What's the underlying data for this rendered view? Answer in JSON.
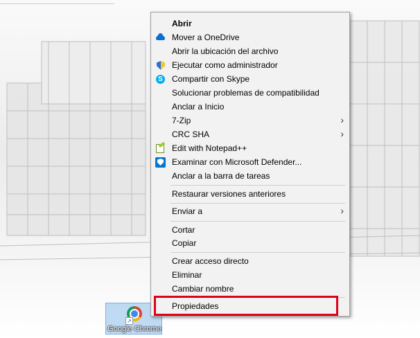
{
  "desktop": {
    "icon_label": "Google Chrome"
  },
  "menu": {
    "items": [
      {
        "label": "Abrir",
        "icon": "none",
        "submenu": false,
        "bold": true
      },
      {
        "label": "Mover a OneDrive",
        "icon": "onedrive-cloud-icon",
        "submenu": false
      },
      {
        "label": "Abrir la ubicación del archivo",
        "icon": "none",
        "submenu": false
      },
      {
        "label": "Ejecutar como administrador",
        "icon": "uac-shield-icon",
        "submenu": false
      },
      {
        "label": "Compartir con Skype",
        "icon": "skype-icon",
        "submenu": false
      },
      {
        "label": "Solucionar problemas de compatibilidad",
        "icon": "none",
        "submenu": false
      },
      {
        "label": "Anclar a Inicio",
        "icon": "none",
        "submenu": false
      },
      {
        "label": "7-Zip",
        "icon": "none",
        "submenu": true
      },
      {
        "label": "CRC SHA",
        "icon": "none",
        "submenu": true
      },
      {
        "label": "Edit with Notepad++",
        "icon": "notepad-plus-plus-icon",
        "submenu": false
      },
      {
        "label": "Examinar con Microsoft Defender...",
        "icon": "defender-icon",
        "submenu": false
      },
      {
        "label": "Anclar a la barra de tareas",
        "icon": "none",
        "submenu": false
      },
      {
        "label": "Restaurar versiones anteriores",
        "icon": "none",
        "submenu": false
      },
      {
        "label": "Enviar a",
        "icon": "none",
        "submenu": true
      },
      {
        "label": "Cortar",
        "icon": "none",
        "submenu": false
      },
      {
        "label": "Copiar",
        "icon": "none",
        "submenu": false
      },
      {
        "label": "Crear acceso directo",
        "icon": "none",
        "submenu": false
      },
      {
        "label": "Eliminar",
        "icon": "none",
        "submenu": false
      },
      {
        "label": "Cambiar nombre",
        "icon": "none",
        "submenu": false
      },
      {
        "label": "Propiedades",
        "icon": "none",
        "submenu": false,
        "highlighted": true
      }
    ],
    "highlight_color": "#e0001a"
  }
}
